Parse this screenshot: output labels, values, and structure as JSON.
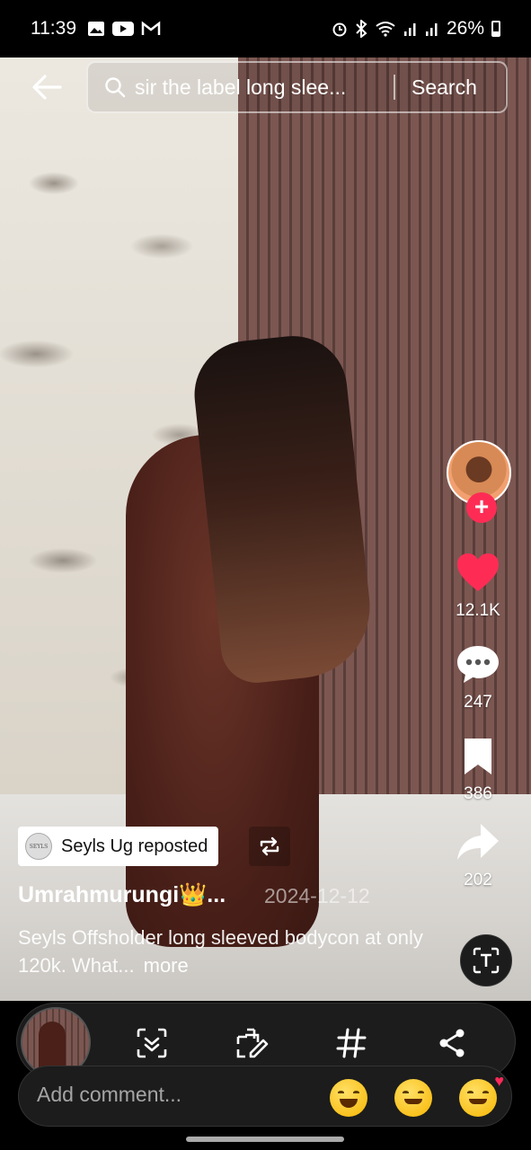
{
  "status_bar": {
    "time": "11:39",
    "battery": "26%",
    "notification_icons": [
      "gallery-icon",
      "youtube-icon",
      "gmail-icon"
    ],
    "system_icons": [
      "alarm-icon",
      "bluetooth-icon",
      "wifi-icon",
      "signal-icon",
      "signal-icon",
      "battery-icon"
    ]
  },
  "search": {
    "query": "sir the label long slee...",
    "button_label": "Search"
  },
  "rail": {
    "likes": "12.1K",
    "comments": "247",
    "saves": "386",
    "shares": "202"
  },
  "post": {
    "repost_label": "Seyls Ug reposted",
    "repost_logo_text": "SEYLS",
    "username": "Umrahmurungi👑...",
    "date": "2024-12-12",
    "caption": "Seyls Offsholder long sleeved bodycon at only 120k. What...",
    "more_label": "more"
  },
  "comment": {
    "placeholder": "Add comment..."
  },
  "colors": {
    "like": "#fe2c55",
    "follow": "#fe2c55",
    "background": "#000000"
  }
}
